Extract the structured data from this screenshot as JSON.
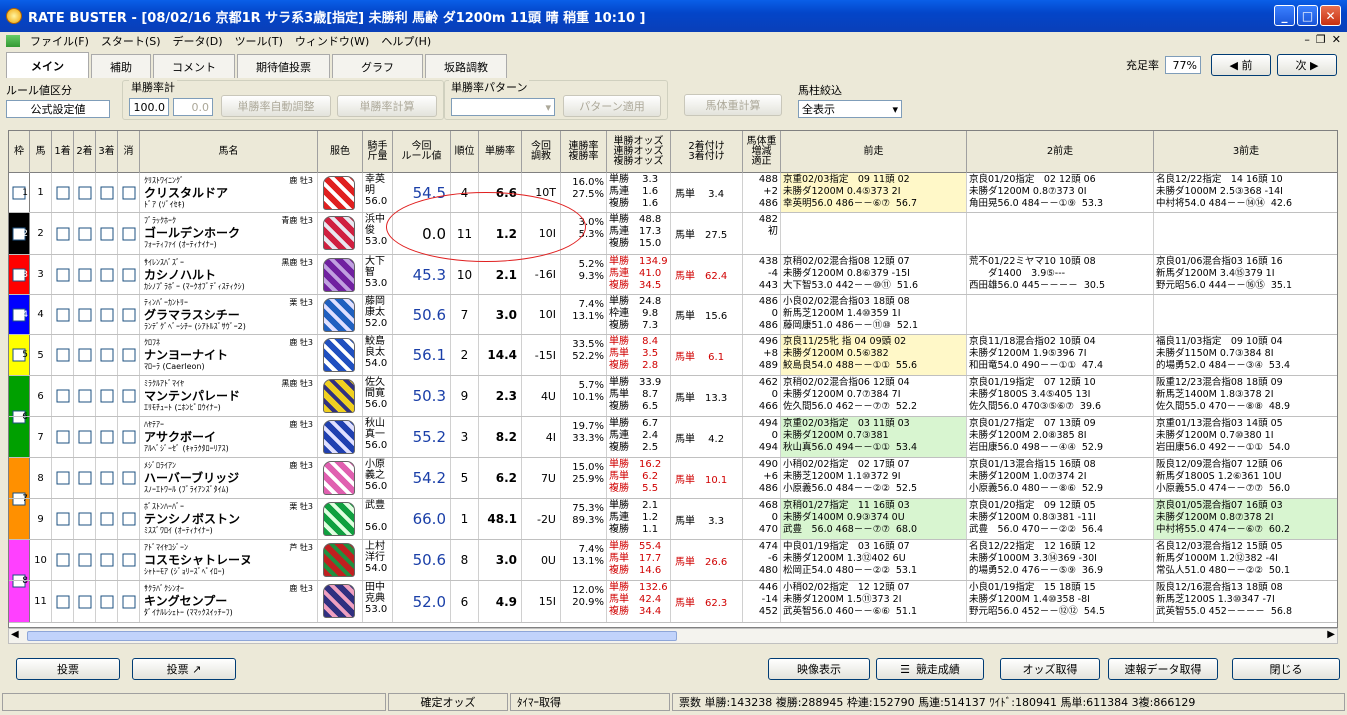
{
  "title": "RATE BUSTER - [08/02/16 京都1R サラ系3歳[指定] 未勝利 馬齢 ダ1200m 11頭 晴 稍重 10:10 ]",
  "menu": [
    "ファイル(F)",
    "スタート(S)",
    "データ(D)",
    "ツール(T)",
    "ウィンドウ(W)",
    "ヘルプ(H)"
  ],
  "tabs": [
    "メイン",
    "補助",
    "コメント",
    "期待値投票",
    "グラフ",
    "坂路調教"
  ],
  "top_right": {
    "label": "充足率",
    "value": "77%",
    "prev": "◀ 前",
    "next": "次 ▶"
  },
  "controls": {
    "rule_group": "ルール値区分",
    "rule_value": "公式設定値",
    "tan_group": "単勝率計",
    "tan_val1": "100.0",
    "tan_val2": "0.0",
    "auto_btn": "単勝率自動調整",
    "calc_btn": "単勝率計算",
    "pattern_group": "単勝率パターン",
    "pattern_btn": "パターン適用",
    "weight_btn": "馬体重計算",
    "filter_group": "馬柱絞込",
    "filter_value": "全表示"
  },
  "headers": [
    "枠",
    "馬",
    "1着",
    "2着",
    "3着",
    "消",
    "馬名",
    "服色",
    "騎手\n斤量",
    "今回\nルール値",
    "順位",
    "単勝率",
    "今回\n調教",
    "連勝率\n複勝率",
    "単勝オッズ\n連勝オッズ\n複勝オッズ",
    "2着付け\n3着付け",
    "馬体重\n増減\n適正",
    "前走",
    "2前走",
    "3前走"
  ],
  "rows": [
    {
      "waku": "1",
      "num": "1",
      "sire": "ｸﾘｽﾄﾜｲﾆﾝｸﾞ",
      "sex": "鹿 牡3",
      "name": "クリスタルドア",
      "dam": "ﾄﾞｱ (ｿﾞｲｾｷ)",
      "jockey": "幸英\n明\n56.0",
      "rule": "54.5",
      "rank": "4",
      "tan": "6.6",
      "train": "10T",
      "ren": "16.0%\n27.5%",
      "odds": "単勝　 3.3\n馬連　 1.6\n複勝　 1.6",
      "tsuke": "馬単　 3.4",
      "weight": "488\n+2\n486",
      "p1": "京重02/03指定　09 11頭 02\n未勝ダ1200M 0.4⑤373 2I\n幸英明56.0 486－－⑥⑦  56.7",
      "p2": "京良01/20指定　02 12頭 06\n未勝ダ1200M 0.8⑦373 0I\n角田晃56.0 484－－①⑨  53.3",
      "p3": "名良12/22指定　14 16頭 10\n未勝ダ1000M 2.5③368 -14I\n中村将54.0 484－－⑭⑭  42.6",
      "p1bg": "#fff8c8"
    },
    {
      "waku": "2",
      "num": "2",
      "sire": "ﾌﾞﾗｯｸﾎｰｸ",
      "sex": "青鹿 牡3",
      "name": "ゴールデンホーク",
      "dam": "ﾌｫｰﾃｨﾌｧｲ (ｵｰﾃｨﾅｲﾅｰ)",
      "jockey": "浜中\n俊\n53.0",
      "rule": "0.0",
      "rank": "11",
      "tan": "1.2",
      "train": "10I",
      "ren": "3.0%\n5.3%",
      "odds": "単勝　48.8\n馬連　17.3\n複勝　15.0",
      "tsuke": "馬単　27.5",
      "weight": "482\n初",
      "p1": "",
      "p2": "",
      "p3": ""
    },
    {
      "waku": "3",
      "num": "3",
      "sire": "ｻｲﾚﾝｽﾊﾞｽﾞｰ",
      "sex": "黒鹿 牡3",
      "name": "カシノハルト",
      "dam": "ｶｼﾉﾌﾟﾗﾎﾞｰ (ﾏｰｸｵﾌﾞﾃﾞｨｽﾃｨｸｼ)",
      "jockey": "大下\n智\n53.0",
      "rule": "45.3",
      "rank": "10",
      "tan": "2.1",
      "train": "-16I",
      "ren": "5.2%\n9.3%",
      "odds": "単勝　134.9\n馬連　41.0\n複勝　34.5",
      "tsuke": "馬単　62.4",
      "weight": "438\n-4\n443",
      "p1": "京稍02/02混合指08 12頭 07\n未勝ダ1200M 0.8⑥379 -15I\n大下智53.0 442－－⑩⑪  51.6",
      "p2": "荒不01/22ミヤマ10 10頭 08\n　　ダ1400　3.9⑤---\n西田雄56.0 445－－－－  30.5",
      "p3": "京良01/06混合指03 16頭 16\n新馬ダ1200M 3.4⑮379 1I\n野元昭56.0 444－－⑯⑮  35.1"
    },
    {
      "waku": "4",
      "num": "4",
      "sire": "ﾃｨﾝﾊﾞｰｶﾝﾄﾘｰ",
      "sex": "栗 牡3",
      "name": "グラマラスシチー",
      "dam": "ﾗﾝﾃﾞｸﾞﾍﾞｰｼﾁｰ (ｼｱﾄﾙｽﾞｻｳﾞｰ2)",
      "jockey": "藤岡\n康太\n52.0",
      "rule": "50.6",
      "rank": "7",
      "tan": "3.0",
      "train": "10I",
      "ren": "7.4%\n13.1%",
      "odds": "単勝　24.8\n枠連　 9.8\n複勝　 7.3",
      "tsuke": "馬単　15.6",
      "weight": "486\n0\n486",
      "p1": "小良02/02混合指03 18頭 08\n新馬芝1200M 1.4⑩359 1I\n藤岡康51.0 486－－⑪⑩  52.1",
      "p2": "",
      "p3": ""
    },
    {
      "waku": "5",
      "num": "5",
      "sire": "ｸﾛﾌﾈ",
      "sex": "鹿 牡3",
      "name": "ナンヨーナイト",
      "dam": "ﾏﾛｰﾗ (Caerleon)",
      "jockey": "鮫島\n良太\n54.0",
      "rule": "56.1",
      "rank": "2",
      "tan": "14.4",
      "train": "-15I",
      "ren": "33.5%\n52.2%",
      "odds": "単勝　 8.4\n馬単　 3.5\n複勝　 2.8",
      "tsuke": "馬単　 6.1",
      "weight": "496\n+8\n489",
      "p1": "京良11/25牝 指 04 09頭 02\n未勝ダ1200M 0.5⑥382\n鮫島良54.0 488－－①①  55.6",
      "p2": "京良11/18混合指02 10頭 04\n未勝ダ1200M 1.9⑤396 7I\n和田竜54.0 490－－①①  47.4",
      "p3": "福良11/03指定　09 10頭 04\n未勝ダ1150M 0.7③384 8I\n的場勇52.0 484－－③④  53.4",
      "p1bg": "#fff8c8"
    },
    {
      "waku": "6",
      "num": "6",
      "sire": "ﾐﾗｸﾙｱﾄﾞﾏｲﾔ",
      "sex": "黒鹿 牡3",
      "name": "マンテンパレード",
      "dam": "ｴﾘﾓﾁｭｰﾄ (ﾆﾎﾝﾋﾟﾛｳｲﾅｰ)",
      "jockey": "佐久\n間寛\n56.0",
      "rule": "50.3",
      "rank": "9",
      "tan": "2.3",
      "train": "4U",
      "ren": "5.7%\n10.1%",
      "odds": "単勝　33.9\n馬単　 8.7\n複勝　 6.5",
      "tsuke": "馬単　13.3",
      "weight": "462\n0\n466",
      "p1": "京稍02/02混合指06 12頭 04\n未勝ダ1200M 0.7⑦384 7I\n佐久間56.0 462－－⑦⑦  52.2",
      "p2": "京良01/19指定　07 12頭 10\n未勝ダ1800S 3.4⑤405 13I\n佐久間56.0 470③⑤⑥⑦  39.6",
      "p3": "阪重12/23混合指08 18頭 09\n新馬芝1400M 1.8③378 2I\n佐久間55.0 470－－⑧⑧  48.9"
    },
    {
      "waku": "6",
      "num": "7",
      "sire": "ﾊﾔﾃｱｰ",
      "sex": "鹿 牡3",
      "name": "アサクボーイ",
      "dam": "ｱﾙﾍﾞｼﾞｰｾﾞ (ｷｬﾗｸﾀﾛｰﾘｱｽ)",
      "jockey": "秋山\n真一\n56.0",
      "rule": "55.2",
      "rank": "3",
      "tan": "8.2",
      "train": "4I",
      "ren": "19.7%\n33.3%",
      "odds": "単勝　 6.7\n馬連　 2.4\n複勝　 2.5",
      "tsuke": "馬単　 4.2",
      "weight": "494\n0\n494",
      "p1": "京重02/03指定　03 11頭 03\n未勝ダ1200M 0.7③381\n秋山真56.0 494－－①①  53.4",
      "p2": "京良01/27指定　07 13頭 09\n未勝ダ1200M 2.0⑧385 8I\n岩田康56.0 498－－④④  52.9",
      "p3": "京重01/13混合指03 14頭 05\n未勝ダ1200M 0.7⑩380 1I\n岩田康56.0 492－－①①  54.0",
      "p1bg": "#d8f5d0"
    },
    {
      "waku": "7",
      "num": "8",
      "sire": "ﾒｼﾞﾛﾗｲｱﾝ",
      "sex": "鹿 牡3",
      "name": "ハーバーブリッジ",
      "dam": "ｽﾉｰｴﾄﾜｰﾙ (ﾌﾞﾗｲｱﾝｽﾞﾀｲﾑ)",
      "jockey": "小原\n義之\n56.0",
      "rule": "54.2",
      "rank": "5",
      "tan": "6.2",
      "train": "7U",
      "ren": "15.0%\n25.9%",
      "odds": "単勝　16.2\n馬単　 6.2\n複勝　 5.5",
      "tsuke": "馬単　10.1",
      "weight": "490\n+6\n486",
      "p1": "小稍02/02指定　02 17頭 07\n未勝芝1200M 1.1⑩372 9I\n小原義56.0 484－－②②  52.5",
      "p2": "京良01/13混合指15 16頭 08\n未勝ダ1200M 1.0⑦374 2I\n小原義56.0 480－－⑧⑥  52.9",
      "p3": "阪良12/09混合指07 12頭 06\n新馬ダ1800S 1.2⑥361 10U\n小原義55.0 474－－⑦⑦  56.0"
    },
    {
      "waku": "7",
      "num": "9",
      "sire": "ﾎﾞｽﾄﾝﾊｰﾊﾞｰ",
      "sex": "栗 牡3",
      "name": "テンシノボストン",
      "dam": "ﾐｽｽﾞﾜﾛｲ (ｵｰﾃｨﾅｲﾅｰ)",
      "jockey": "武豊\n\n56.0",
      "rule": "66.0",
      "rank": "1",
      "tan": "48.1",
      "train": "-2U",
      "ren": "75.3%\n89.3%",
      "odds": "単勝　 2.1\n馬連　 1.2\n複勝　 1.1",
      "tsuke": "馬単　 3.3",
      "weight": "468\n0\n470",
      "p1": "京稍01/27指定　11 16頭 03\n未勝ダ1400M 0.9③374 0U\n武豊　56.0 468－－⑦⑦  68.0",
      "p2": "京良01/20指定　09 12頭 05\n未勝ダ1200M 0.8③381 -11I\n武豊　56.0 470－－②②  56.4",
      "p3": "京良01/05混合指07 16頭 03\n未勝ダ1200M 0.8⑦378 2I\n中村将55.0 474－－⑥⑦  60.2",
      "p1bg": "#d8f5d0",
      "p3bg": "#d8f5d0"
    },
    {
      "waku": "8",
      "num": "10",
      "sire": "ｱﾄﾞﾏｲﾔｺｼﾞｰﾝ",
      "sex": "芦 牡3",
      "name": "コスモシャトレーヌ",
      "dam": "ｼｬﾄｰﾓｱ (ｼﾞｮﾘｰｽﾞﾍﾟｲﾛｰ)",
      "jockey": "上村\n洋行\n54.0",
      "rule": "50.6",
      "rank": "8",
      "tan": "3.0",
      "train": "0U",
      "ren": "7.4%\n13.1%",
      "odds": "単勝　55.4\n馬単　17.7\n複勝　14.6",
      "tsuke": "馬単　26.6",
      "weight": "474\n-6\n480",
      "p1": "中良01/19指定　03 16頭 07\n未勝ダ1200M 1.3⑫402 6U\n松岡正54.0 480－－②②  53.1",
      "p2": "名良12/22指定　12 16頭 12\n未勝ダ1000M 3.3⑭369 -30I\n的場勇52.0 476－－⑤⑨  36.9",
      "p3": "名良12/03混合指12 15頭 05\n新馬ダ1000M 1.2⑫382 -4I\n常弘人51.0 480－－②②  50.1"
    },
    {
      "waku": "8",
      "num": "11",
      "sire": "ｻｸﾗﾊﾞｸｼﾝｵｰ",
      "sex": "鹿 牡3",
      "name": "キングセンプー",
      "dam": "ﾀﾞｲﾅﾙﾚｼｪﾄｰ (ﾏﾏｯｸｽｲｯﾁｰﾌ)",
      "jockey": "田中\n克典\n53.0",
      "rule": "52.0",
      "rank": "6",
      "tan": "4.9",
      "train": "15I",
      "ren": "12.0%\n20.9%",
      "odds": "単勝　132.6\n馬単　42.4\n複勝　34.4",
      "tsuke": "馬単　62.3",
      "weight": "446\n-14\n452",
      "p1": "小稍02/02指定　12 12頭 07\n未勝ダ1200M 1.5⑪373 2I\n武英智56.0 460－－⑥⑥  51.1",
      "p2": "小良01/19指定　15 18頭 15\n未勝ダ1200M 1.4⑩358 -8I\n野元昭56.0 452－－⑫⑫  54.5",
      "p3": "阪良12/16混合指13 18頭 08\n新馬芝1200S 1.3⑩347 -7I\n武英智55.0 452－－－－  56.8"
    }
  ],
  "bottom_left": [
    "投票",
    "投票 ↗"
  ],
  "bottom_right": [
    "映像表示",
    "競走成績",
    "オッズ取得",
    "速報データ取得",
    "閉じる"
  ],
  "status": [
    "確定オッズ",
    "ﾀｲﾏｰ取得",
    "票数 単勝:143238 複勝:288945 枠連:152790 馬連:514137 ﾜｲﾄﾞ:180941 馬単:611384 3複:866129"
  ],
  "colors": {
    "waku1": "#ffffff",
    "waku2": "#000000",
    "waku3": "#ff0000",
    "waku4": "#0000ff",
    "waku5": "#ffff00",
    "waku6": "#00a000",
    "waku7": "#ff9000",
    "waku8": "#ff40ff"
  }
}
